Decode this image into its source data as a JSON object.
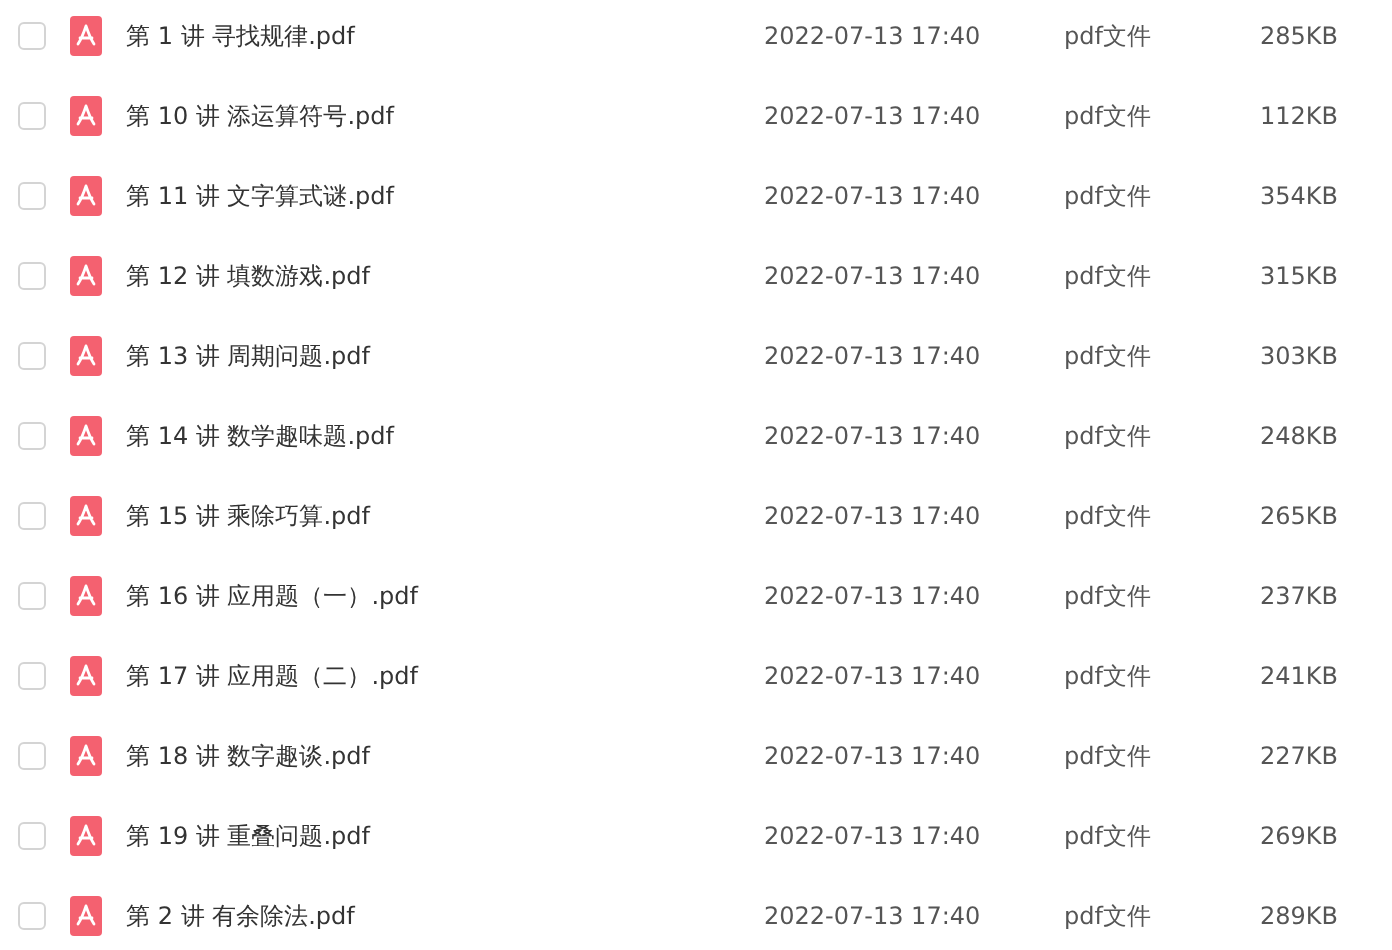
{
  "files": [
    {
      "name": "第 1 讲 寻找规律.pdf",
      "modified": "2022-07-13 17:40",
      "type": "pdf文件",
      "size": "285KB",
      "checked": false
    },
    {
      "name": "第 10 讲 添运算符号.pdf",
      "modified": "2022-07-13 17:40",
      "type": "pdf文件",
      "size": "112KB",
      "checked": false
    },
    {
      "name": "第 11 讲 文字算式谜.pdf",
      "modified": "2022-07-13 17:40",
      "type": "pdf文件",
      "size": "354KB",
      "checked": false
    },
    {
      "name": "第 12 讲 填数游戏.pdf",
      "modified": "2022-07-13 17:40",
      "type": "pdf文件",
      "size": "315KB",
      "checked": false
    },
    {
      "name": "第 13 讲 周期问题.pdf",
      "modified": "2022-07-13 17:40",
      "type": "pdf文件",
      "size": "303KB",
      "checked": false
    },
    {
      "name": "第 14 讲 数学趣味题.pdf",
      "modified": "2022-07-13 17:40",
      "type": "pdf文件",
      "size": "248KB",
      "checked": false
    },
    {
      "name": "第 15 讲 乘除巧算.pdf",
      "modified": "2022-07-13 17:40",
      "type": "pdf文件",
      "size": "265KB",
      "checked": false
    },
    {
      "name": "第 16 讲 应用题（一）.pdf",
      "modified": "2022-07-13 17:40",
      "type": "pdf文件",
      "size": "237KB",
      "checked": false
    },
    {
      "name": "第 17 讲 应用题（二）.pdf",
      "modified": "2022-07-13 17:40",
      "type": "pdf文件",
      "size": "241KB",
      "checked": false
    },
    {
      "name": "第 18 讲 数字趣谈.pdf",
      "modified": "2022-07-13 17:40",
      "type": "pdf文件",
      "size": "227KB",
      "checked": false
    },
    {
      "name": "第 19 讲 重叠问题.pdf",
      "modified": "2022-07-13 17:40",
      "type": "pdf文件",
      "size": "269KB",
      "checked": false
    },
    {
      "name": "第 2 讲 有余除法.pdf",
      "modified": "2022-07-13 17:40",
      "type": "pdf文件",
      "size": "289KB",
      "checked": false
    }
  ]
}
